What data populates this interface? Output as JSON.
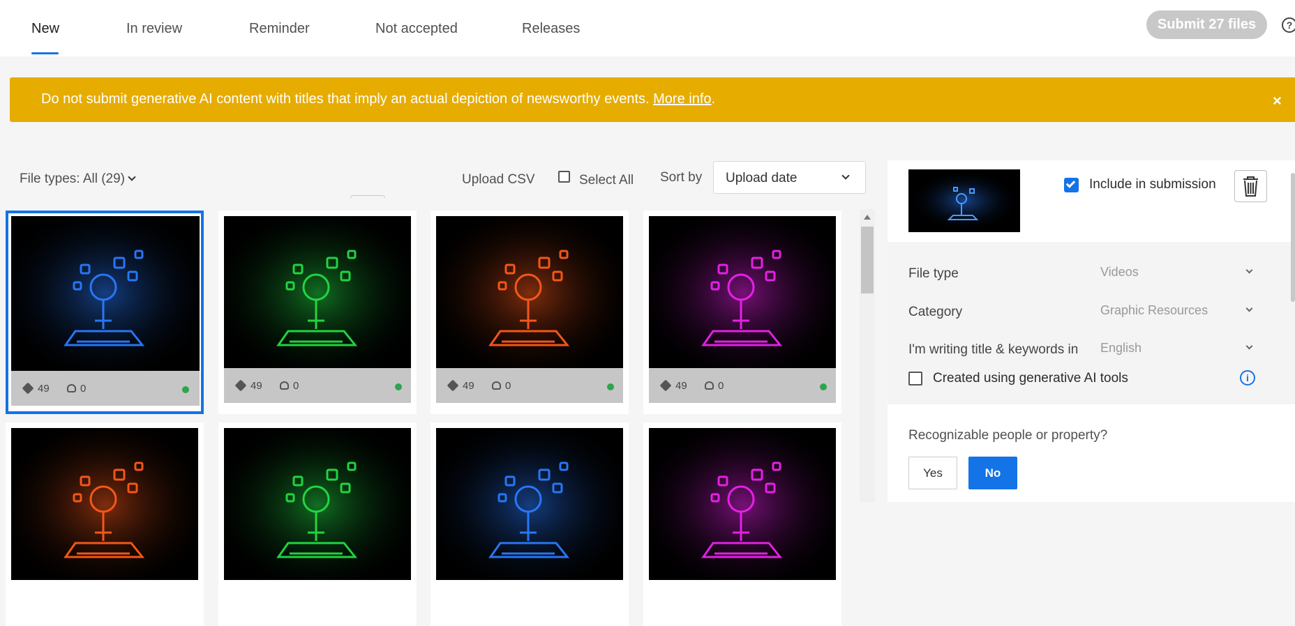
{
  "tabs": [
    {
      "label": "New",
      "active": true
    },
    {
      "label": "In review",
      "active": false
    },
    {
      "label": "Reminder",
      "active": false
    },
    {
      "label": "Not accepted",
      "active": false
    },
    {
      "label": "Releases",
      "active": false
    }
  ],
  "header": {
    "submit_label": "Submit 27 files",
    "help_icon": "?"
  },
  "banner": {
    "text": "Do not submit generative AI content with titles that imply an actual depiction of newsworthy events.",
    "link_text": "More info",
    "suffix": ".",
    "close_icon": "×"
  },
  "toolbar": {
    "file_types_label": "File types: All (29)",
    "upload_csv_label": "Upload CSV",
    "select_all_label": "Select All",
    "sort_by_label": "Sort by",
    "sort_value": "Upload date"
  },
  "cards": [
    {
      "keywords": "49",
      "people": "0",
      "color": "#2a7bff",
      "selected": true
    },
    {
      "keywords": "49",
      "people": "0",
      "color": "#22dd44",
      "selected": false
    },
    {
      "keywords": "49",
      "people": "0",
      "color": "#ff5a1a",
      "selected": false
    },
    {
      "keywords": "49",
      "people": "0",
      "color": "#ee22ee",
      "selected": false
    },
    {
      "keywords": "",
      "people": "",
      "color": "#ff5a1a",
      "selected": false
    },
    {
      "keywords": "",
      "people": "",
      "color": "#22dd44",
      "selected": false
    },
    {
      "keywords": "",
      "people": "",
      "color": "#2a7bff",
      "selected": false
    },
    {
      "keywords": "",
      "people": "",
      "color": "#ee22ee",
      "selected": false
    }
  ],
  "panel": {
    "include_label": "Include in submission",
    "fields": [
      {
        "label": "File type",
        "value": "Videos"
      },
      {
        "label": "Category",
        "value": "Graphic Resources"
      },
      {
        "label": "I'm writing title & keywords in",
        "value": "English"
      }
    ],
    "ai_label": "Created using generative AI tools",
    "info_icon": "i",
    "recognizable_label": "Recognizable people or property?",
    "yes_label": "Yes",
    "no_label": "No"
  },
  "colors": {
    "accent": "#1473e6",
    "banner": "#e6ac00",
    "status_green": "#2da44e"
  }
}
